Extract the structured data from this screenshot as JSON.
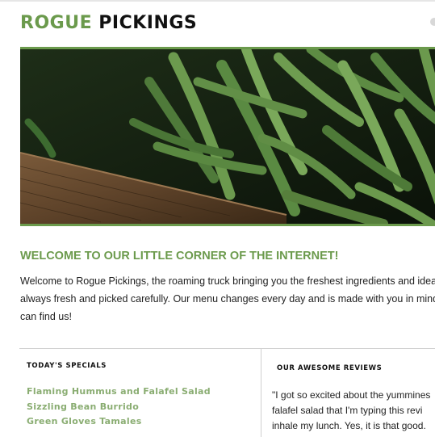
{
  "brand": {
    "part1": "ROGUE",
    "part2": "PICKINGS"
  },
  "hero": {
    "alt": "green beans on wooden crate"
  },
  "welcome": {
    "title": "WELCOME TO OUR LITTLE CORNER OF THE INTERNET!",
    "body": "Welcome to Rogue Pickings, the roaming truck bringing you the freshest ingredients and ideas always fresh and picked carefully. Our menu changes every day and is made with you in mind. W can find us!"
  },
  "specials": {
    "heading": "TODAY'S SPECIALS",
    "items": [
      "Flaming Hummus and Falafel Salad",
      "Sizzling Bean Burrido",
      "Green Gloves Tamales"
    ]
  },
  "reviews": {
    "heading": "OUR AWESOME REVIEWS",
    "text": "\"I got so excited about the yummines falafel salad that I'm typing this revi inhale my lunch. Yes, it is that good."
  },
  "colors": {
    "accent": "#6b9a4c",
    "specials": "#8aad72"
  }
}
